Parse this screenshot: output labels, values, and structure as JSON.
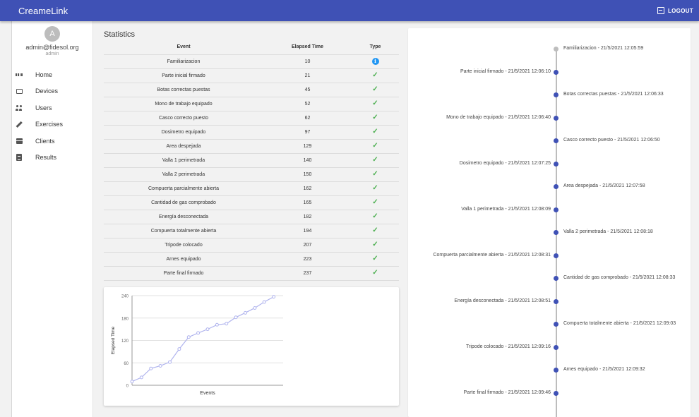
{
  "app": {
    "title": "CreameLink",
    "logout_label": "LOGOUT"
  },
  "sidebar": {
    "avatar_initial": "A",
    "user_email": "admin@fidesol.org",
    "user_role": "admin",
    "items": [
      {
        "label": "Home",
        "icon": "dashboard-icon"
      },
      {
        "label": "Devices",
        "icon": "devices-icon"
      },
      {
        "label": "Users",
        "icon": "users-icon"
      },
      {
        "label": "Exercises",
        "icon": "pencil-icon"
      },
      {
        "label": "Clients",
        "icon": "briefcase-icon"
      },
      {
        "label": "Results",
        "icon": "clipboard-icon"
      }
    ]
  },
  "statistics": {
    "title": "Statistics",
    "headers": {
      "event": "Event",
      "elapsed": "Elapsed Time",
      "type": "Type"
    },
    "rows": [
      {
        "event": "Familiarizacion",
        "elapsed": "10",
        "type": "info"
      },
      {
        "event": "Parte inicial firmado",
        "elapsed": "21",
        "type": "check"
      },
      {
        "event": "Botas correctas puestas",
        "elapsed": "45",
        "type": "check"
      },
      {
        "event": "Mono de trabajo equipado",
        "elapsed": "52",
        "type": "check"
      },
      {
        "event": "Casco correcto puesto",
        "elapsed": "62",
        "type": "check"
      },
      {
        "event": "Dosimetro equipado",
        "elapsed": "97",
        "type": "check"
      },
      {
        "event": "Area despejada",
        "elapsed": "129",
        "type": "check"
      },
      {
        "event": "Valla 1 perimetrada",
        "elapsed": "140",
        "type": "check"
      },
      {
        "event": "Valla 2 perimetrada",
        "elapsed": "150",
        "type": "check"
      },
      {
        "event": "Compuerta parcialmente abierta",
        "elapsed": "162",
        "type": "check"
      },
      {
        "event": "Cantidad de gas comprobado",
        "elapsed": "165",
        "type": "check"
      },
      {
        "event": "Energía desconectada",
        "elapsed": "182",
        "type": "check"
      },
      {
        "event": "Compuerta totalmente abierta",
        "elapsed": "194",
        "type": "check"
      },
      {
        "event": "Tripode colocado",
        "elapsed": "207",
        "type": "check"
      },
      {
        "event": "Arnes equipado",
        "elapsed": "223",
        "type": "check"
      },
      {
        "event": "Parte final firmado",
        "elapsed": "237",
        "type": "check"
      }
    ]
  },
  "colors": {
    "primary": "#3f51b5",
    "check": "#4caf50",
    "info": "#2196f3",
    "line": "#b0b4ee",
    "grey": "#bdbdbd"
  },
  "chart_data": {
    "type": "line",
    "xlabel": "Events",
    "ylabel": "Elapsed Time",
    "ylim": [
      0,
      240
    ],
    "yticks": [
      0,
      60,
      120,
      180,
      240
    ],
    "x": [
      0,
      1,
      2,
      3,
      4,
      5,
      6,
      7,
      8,
      9,
      10,
      11,
      12,
      13,
      14,
      15,
      16
    ],
    "values": [
      10,
      21,
      45,
      52,
      62,
      97,
      129,
      140,
      150,
      162,
      165,
      182,
      194,
      207,
      223,
      237
    ],
    "grid": true
  },
  "timeline": [
    {
      "text": "Familiarizacion - 21/5/2021 12:05:59",
      "side": "right",
      "dot": "grey"
    },
    {
      "text": "Parte inicial firmado - 21/5/2021 12:06:10",
      "side": "left",
      "dot": "blue"
    },
    {
      "text": "Botas correctas puestas - 21/5/2021 12:06:33",
      "side": "right",
      "dot": "blue"
    },
    {
      "text": "Mono de trabajo equipado - 21/5/2021 12:06:40",
      "side": "left",
      "dot": "blue"
    },
    {
      "text": "Casco correcto puesto - 21/5/2021 12:06:50",
      "side": "right",
      "dot": "blue"
    },
    {
      "text": "Dosimetro equipado - 21/5/2021 12:07:25",
      "side": "left",
      "dot": "blue"
    },
    {
      "text": "Area despejada - 21/5/2021 12:07:58",
      "side": "right",
      "dot": "blue"
    },
    {
      "text": "Valla 1 perimetrada - 21/5/2021 12:08:09",
      "side": "left",
      "dot": "blue"
    },
    {
      "text": "Valla 2 perimetrada - 21/5/2021 12:08:18",
      "side": "right",
      "dot": "blue"
    },
    {
      "text": "Compuerta parcialmente abierta - 21/5/2021 12:08:31",
      "side": "left",
      "dot": "blue"
    },
    {
      "text": "Cantidad de gas comprobado - 21/5/2021 12:08:33",
      "side": "right",
      "dot": "blue"
    },
    {
      "text": "Energía desconectada - 21/5/2021 12:08:51",
      "side": "left",
      "dot": "blue"
    },
    {
      "text": "Compuerta totalmente abierta - 21/5/2021 12:09:03",
      "side": "right",
      "dot": "blue"
    },
    {
      "text": "Tripode colocado - 21/5/2021 12:09:16",
      "side": "left",
      "dot": "blue"
    },
    {
      "text": "Arnes equipado - 21/5/2021 12:09:32",
      "side": "right",
      "dot": "blue"
    },
    {
      "text": "Parte final firmado - 21/5/2021 12:09:46",
      "side": "left",
      "dot": "blue"
    }
  ]
}
